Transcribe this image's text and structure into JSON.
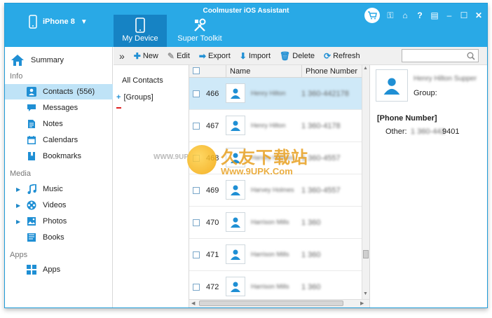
{
  "app": {
    "title": "Coolmuster iOS Assistant"
  },
  "device": {
    "name": "iPhone 8"
  },
  "tabs": [
    {
      "label": "My Device"
    },
    {
      "label": "Super Toolkit"
    }
  ],
  "sidebar": {
    "summary": "Summary",
    "sections": {
      "info": "Info",
      "media": "Media",
      "apps": "Apps"
    },
    "items": [
      {
        "label": "Contacts",
        "count": "(556)"
      },
      {
        "label": "Messages"
      },
      {
        "label": "Notes"
      },
      {
        "label": "Calendars"
      },
      {
        "label": "Bookmarks"
      },
      {
        "label": "Music"
      },
      {
        "label": "Videos"
      },
      {
        "label": "Photos"
      },
      {
        "label": "Books"
      },
      {
        "label": "Apps"
      }
    ]
  },
  "toolbar": {
    "collapse": "»",
    "new": "New",
    "edit": "Edit",
    "export": "Export",
    "import": "Import",
    "delete": "Delete",
    "refresh": "Refresh",
    "search_placeholder": ""
  },
  "groups": {
    "all": "All Contacts",
    "groups": "[Groups]"
  },
  "table": {
    "columns": {
      "name": "Name",
      "phone": "Phone Number"
    },
    "rows": [
      {
        "id": "466",
        "name": "Henry Hilton",
        "phone": "1 360-442178",
        "selected": true
      },
      {
        "id": "467",
        "name": "Henry Hilton",
        "phone": "1 360-4178",
        "selected": false
      },
      {
        "id": "468",
        "name": "Harvey Holmes",
        "phone": "1 360-4557",
        "selected": false
      },
      {
        "id": "469",
        "name": "Harvey Holmes",
        "phone": "1 360-4557",
        "selected": false
      },
      {
        "id": "470",
        "name": "Harrison Mills",
        "phone": "1 360",
        "selected": false
      },
      {
        "id": "471",
        "name": "Harrison Mills",
        "phone": "1 360",
        "selected": false
      },
      {
        "id": "472",
        "name": "Harrison Mills",
        "phone": "1 360",
        "selected": false
      }
    ]
  },
  "detail": {
    "name": "Henry Hilton Supper",
    "group_label": "Group:",
    "phone_header": "[Phone Number]",
    "other_label": "Other:",
    "other_value_hidden": "1 360-442",
    "other_value_tail": "9401"
  },
  "watermark": {
    "url1": "WWW.9UPK.COM",
    "big": "久友下载站",
    "url2": "Www.9UPK.Com"
  },
  "colors": {
    "header": "#29a9e6",
    "active_tab": "#1683c4",
    "selection": "#cfe9f8",
    "sidebar_active": "#bfe3f7",
    "accent": "#1f8fd4"
  }
}
